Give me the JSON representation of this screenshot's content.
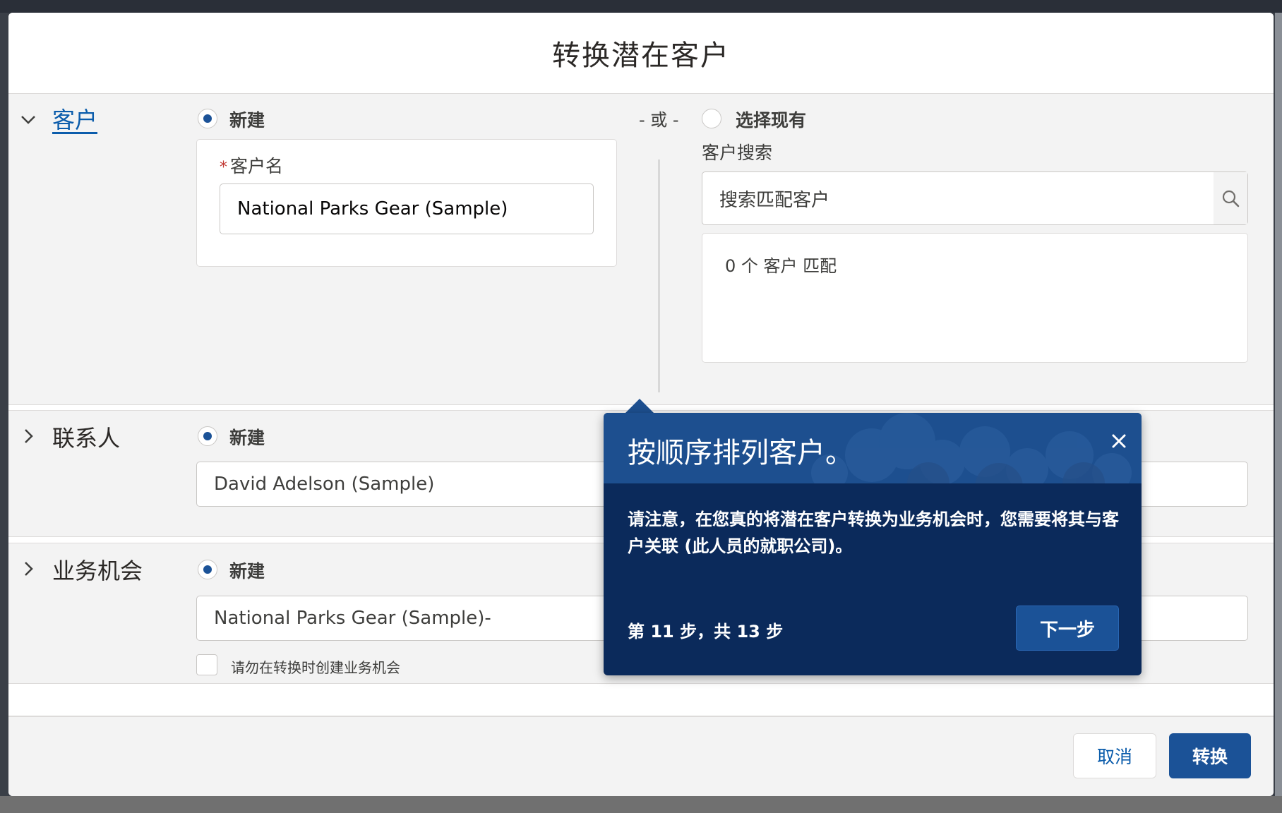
{
  "modal": {
    "title": "转换潜在客户"
  },
  "account": {
    "section_label": "客户",
    "new_label": "新建",
    "or_label": "- 或 -",
    "existing_label": "选择现有",
    "name_label": "客户名",
    "name_value": "National Parks Gear (Sample)",
    "search_label": "客户搜索",
    "search_placeholder": "搜索匹配客户",
    "match_text": "0 个 客户 匹配"
  },
  "contact": {
    "section_label": "联系人",
    "new_label": "新建",
    "name_value": "David Adelson (Sample)"
  },
  "opportunity": {
    "section_label": "业务机会",
    "new_label": "新建",
    "name_value": "National Parks Gear (Sample)-",
    "no_create_label": "请勿在转换时创建业务机会"
  },
  "footer": {
    "cancel_label": "取消",
    "convert_label": "转换"
  },
  "walkthrough": {
    "title": "按顺序排列客户。",
    "body": "请注意，在您真的将潜在客户转换为业务机会时，您需要将其与客户关联 (此人员的就职公司)。",
    "step_text": "第 11 步，共 13 步",
    "next_label": "下一步"
  },
  "colors": {
    "brand": "#1b5297",
    "popover_bg": "#0b2a5b",
    "popover_header": "#1d4f8f",
    "required": "#c23934"
  }
}
